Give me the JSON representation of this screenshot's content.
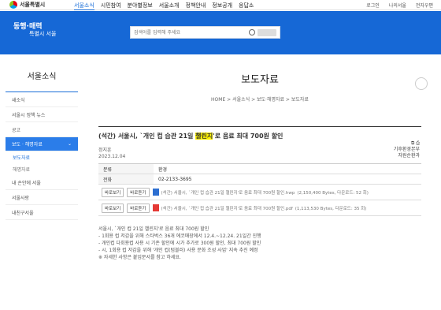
{
  "header": {
    "logo_text": "서울특별시",
    "menu": [
      "서울소식",
      "시민참여",
      "분야별정보",
      "서울소개",
      "정책안내",
      "정보공개",
      "응답소"
    ],
    "util": [
      "로그인",
      "나의서울",
      "전자우편"
    ]
  },
  "banner": {
    "slogan_line1": "동행·매력",
    "slogan_line2": "특별시 서울",
    "search_placeholder": "검색어를 입력해 주세요"
  },
  "sidebar": {
    "title": "서울소식",
    "items": [
      "새소식",
      "서울시 정책 뉴스",
      "공고"
    ],
    "active": "보도 · 해명자료",
    "sub": [
      "보도자료",
      "해명자료"
    ],
    "after": [
      "내 손안에 서울",
      "서울사랑",
      "내친구서울"
    ]
  },
  "page": {
    "title": "보도자료",
    "breadcrumb": "HOME > 서울소식 > 보도·해명자료 > 보도자료"
  },
  "article": {
    "title_before": "(석간) 서울시, `개인 컵 습관 21일 ",
    "title_highlight": "챌린지",
    "title_after": "'로 음료 최대 700원 할인",
    "author_label": "정지훈",
    "date": "2023.12.04",
    "dept_line1": "기후환경본부",
    "dept_line2": "자원순환과",
    "rows": [
      {
        "label": "분류",
        "value": "환경"
      },
      {
        "label": "전화",
        "value": "02-2133-3695"
      }
    ],
    "attachments": [
      {
        "view": "바로보기",
        "listen": "바로듣기",
        "name": "(석간) 서울시, `개인 컵 습관 21일 챌린지'로 음료 최대 700원 할인.hwp",
        "meta": "(2,150,400 Bytes, 다운로드: 52 회)"
      },
      {
        "view": "바로보기",
        "listen": "바로듣기",
        "name": "(석간) 서울시, `개인 컵 습관 21일 챌린지'로 음료 최대 700원 할인.pdf",
        "meta": "(1,113,530 Bytes, 다운로드: 35 회)"
      }
    ],
    "body": [
      "서울시, `개인 컵 21일 챌린지'로 음료 최대 700원 할인",
      "- 1회용 컵 저감을 위해 스타벅스 36개 에코매장에서 12.4.~12.24. 21일간 진행",
      "- 개인컵 다회용컵 사용 시 기존 할인에 시가 추가로 300원 할인, 최대 700원 할인",
      "- 시, 1회용 컵 저감을 위해 '개인 컵(텀블러) 사용 문화 조성 사업' 지속 추진 예정",
      "※ 자세한 사항은 붙임문서를 참고 하세요."
    ]
  }
}
